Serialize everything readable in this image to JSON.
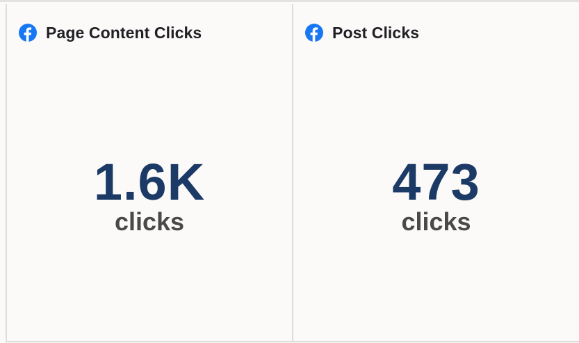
{
  "widgets": [
    {
      "title": "Page Content Clicks",
      "icon": "facebook-icon",
      "value": "1.6K",
      "unit": "clicks"
    },
    {
      "title": "Post Clicks",
      "icon": "facebook-icon",
      "value": "473",
      "unit": "clicks"
    }
  ],
  "colors": {
    "facebook_blue": "#1877f2",
    "metric_value": "#1c3a66",
    "metric_unit": "#4a4848",
    "title": "#1f1f24",
    "card_background": "#fbfaf9",
    "border": "#dedcda"
  }
}
